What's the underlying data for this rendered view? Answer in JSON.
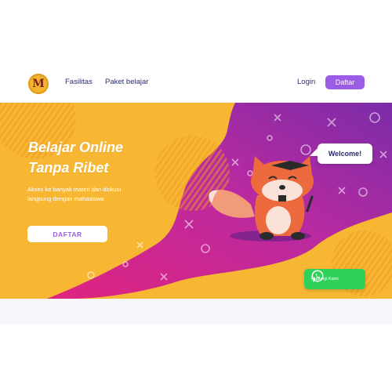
{
  "navbar": {
    "logo_letter": "M",
    "links": [
      "Fasilitas",
      "Paket belajar"
    ],
    "login_label": "Login",
    "cta_label": "Daftar"
  },
  "hero": {
    "headline_line1": "Belajar Online",
    "headline_line2": "Tanpa Ribet",
    "subtext": "Akses ke banyak materi dan diskusi langsung dengan mahasiswa",
    "cta_label": "DAFTAR",
    "bubble_text": "Welcome!"
  },
  "whatsapp": {
    "label": "Hubungi Kami",
    "icon": "whatsapp-icon"
  },
  "colors": {
    "primary": "#9b5de5",
    "hero_yellow": "#f7b733",
    "hero_magenta": "#d6268f",
    "hero_purple": "#7b2ca8",
    "whatsapp_green": "#2fd15a"
  }
}
